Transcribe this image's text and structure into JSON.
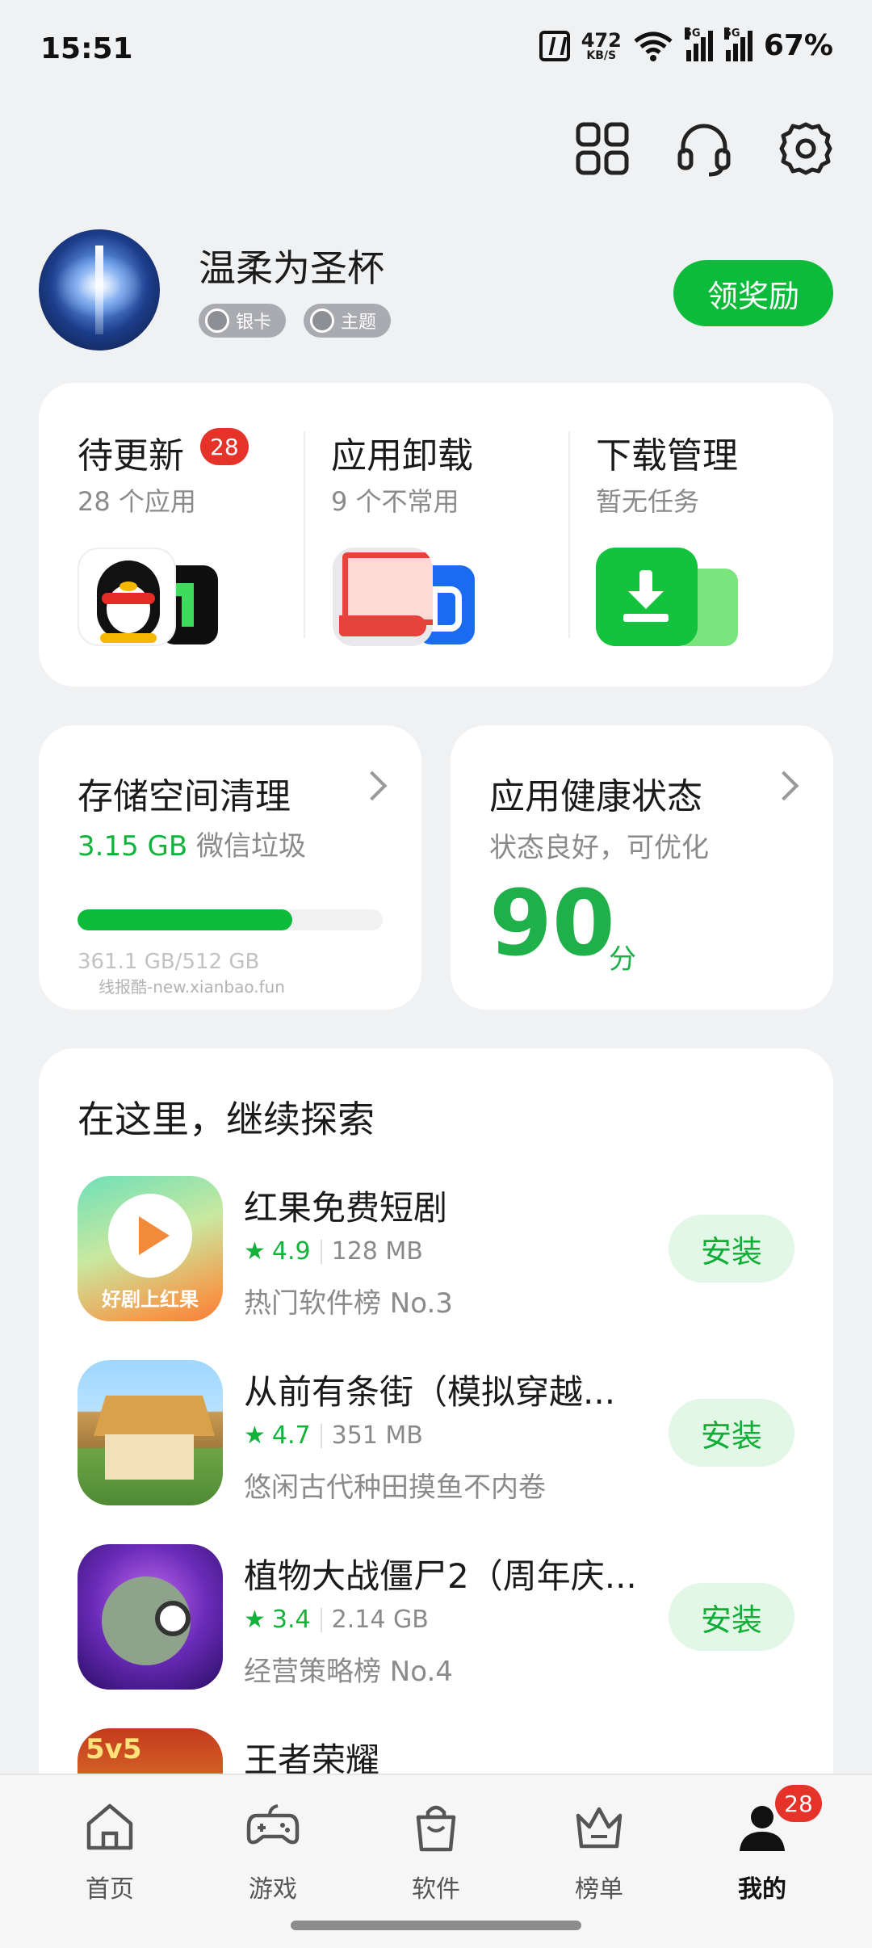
{
  "status_bar": {
    "time": "15:51",
    "speed_value": "472",
    "speed_unit": "KB/S",
    "sim1_tech": "5G",
    "sim2_tech": "5G",
    "battery": "67%"
  },
  "profile": {
    "username": "温柔为圣杯",
    "badges": [
      "银卡",
      "主题"
    ],
    "reward_button": "领奖励"
  },
  "management": {
    "updates": {
      "title": "待更新",
      "count": "28",
      "subtitle": "28 个应用"
    },
    "uninstall": {
      "title": "应用卸载",
      "subtitle": "9 个不常用"
    },
    "downloads": {
      "title": "下载管理",
      "subtitle": "暂无任务"
    }
  },
  "storage": {
    "title": "存储空间清理",
    "highlight": "3.15 GB",
    "highlight_suffix": " 微信垃圾",
    "used_fraction": 0.705,
    "capacity": "361.1 GB/512 GB",
    "watermark": "线报酷-new.xianbao.fun"
  },
  "health": {
    "title": "应用健康状态",
    "subtitle": "状态良好，可优化",
    "score": "90",
    "score_unit": "分"
  },
  "explore": {
    "title": "在这里，继续探索",
    "apps": [
      {
        "name": "红果免费短剧",
        "rating": "4.9",
        "size": "128 MB",
        "desc": "热门软件榜 No.3",
        "button": "安装",
        "icon_caption": "好剧上红果"
      },
      {
        "name": "从前有条街（模拟穿越...",
        "rating": "4.7",
        "size": "351 MB",
        "desc": "悠闲古代种田摸鱼不内卷",
        "button": "安装"
      },
      {
        "name": "植物大战僵尸2（周年庆...",
        "rating": "3.4",
        "size": "2.14 GB",
        "desc": "经营策略榜 No.4",
        "button": "安装"
      },
      {
        "name": "王者荣耀",
        "icon_caption": "5v5"
      }
    ]
  },
  "bottom_nav": {
    "items": [
      "首页",
      "游戏",
      "软件",
      "榜单",
      "我的"
    ],
    "badge": "28"
  },
  "colors": {
    "accent_green": "#0dbb3a",
    "badge_red": "#e5332a",
    "background": "#f0f1f3"
  },
  "icons": [
    "apps-grid-icon",
    "headset-icon",
    "settings-gear-icon",
    "chevron-right-icon",
    "star-icon",
    "home-icon",
    "gamepad-icon",
    "shopping-bag-icon",
    "crown-icon",
    "person-icon"
  ]
}
